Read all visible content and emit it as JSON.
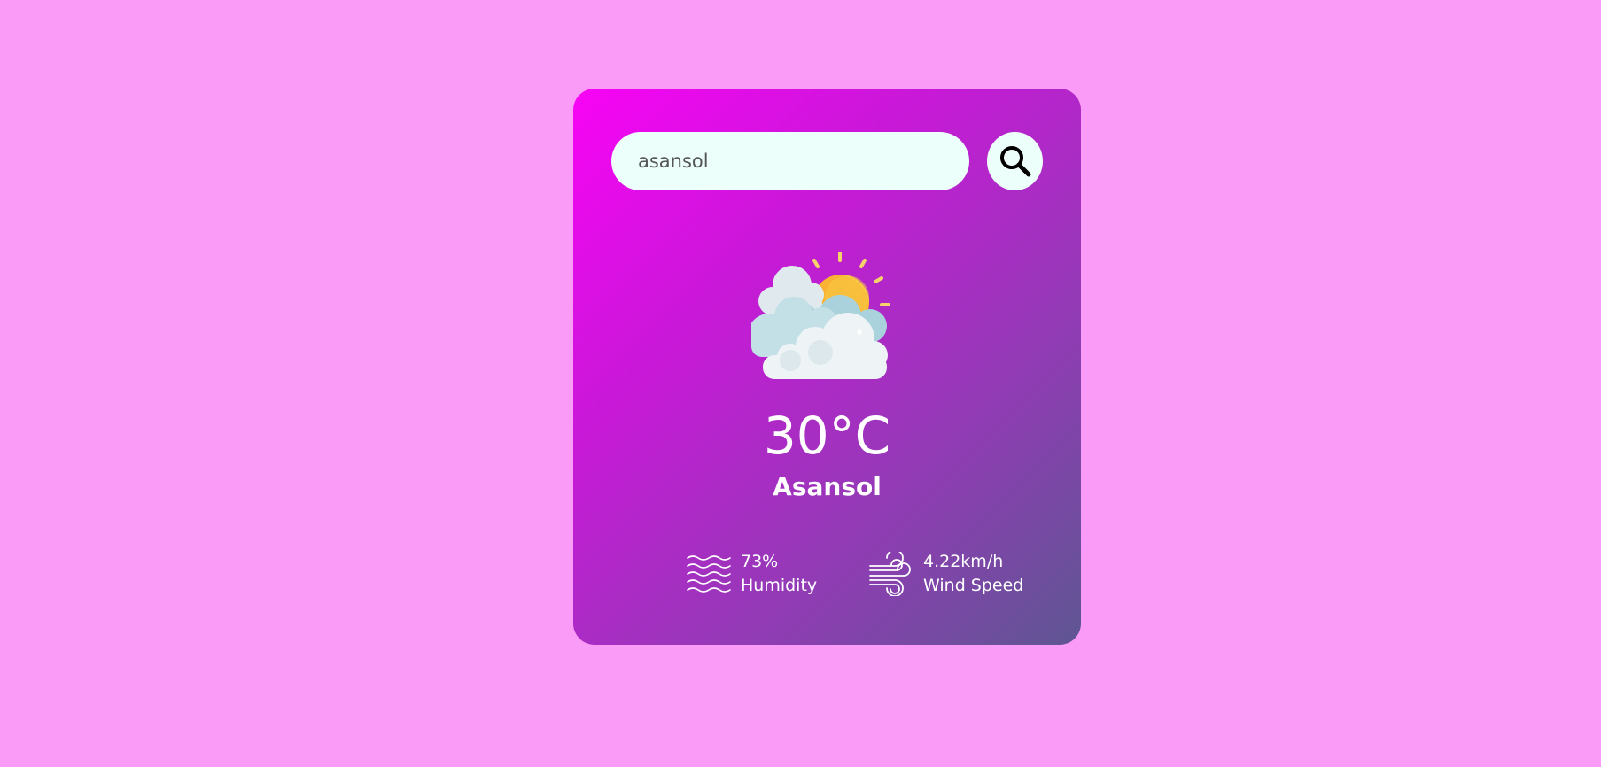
{
  "search": {
    "value": "asansol"
  },
  "weather": {
    "icon": "partly-cloudy-sun-icon",
    "temperature": "30°C",
    "city": "Asansol"
  },
  "details": {
    "humidity": {
      "icon": "humidity-waves-icon",
      "value": "73%",
      "label": "Humidity"
    },
    "wind": {
      "icon": "wind-icon",
      "value": "4.22km/h",
      "label": "Wind Speed"
    }
  },
  "colors": {
    "page_background": "#f99bf7",
    "card_gradient_start": "#f803f5",
    "card_gradient_end": "#5e5692",
    "input_background": "#ecfffa",
    "sun": "#f9b233",
    "cloud": "#eef4f6"
  }
}
